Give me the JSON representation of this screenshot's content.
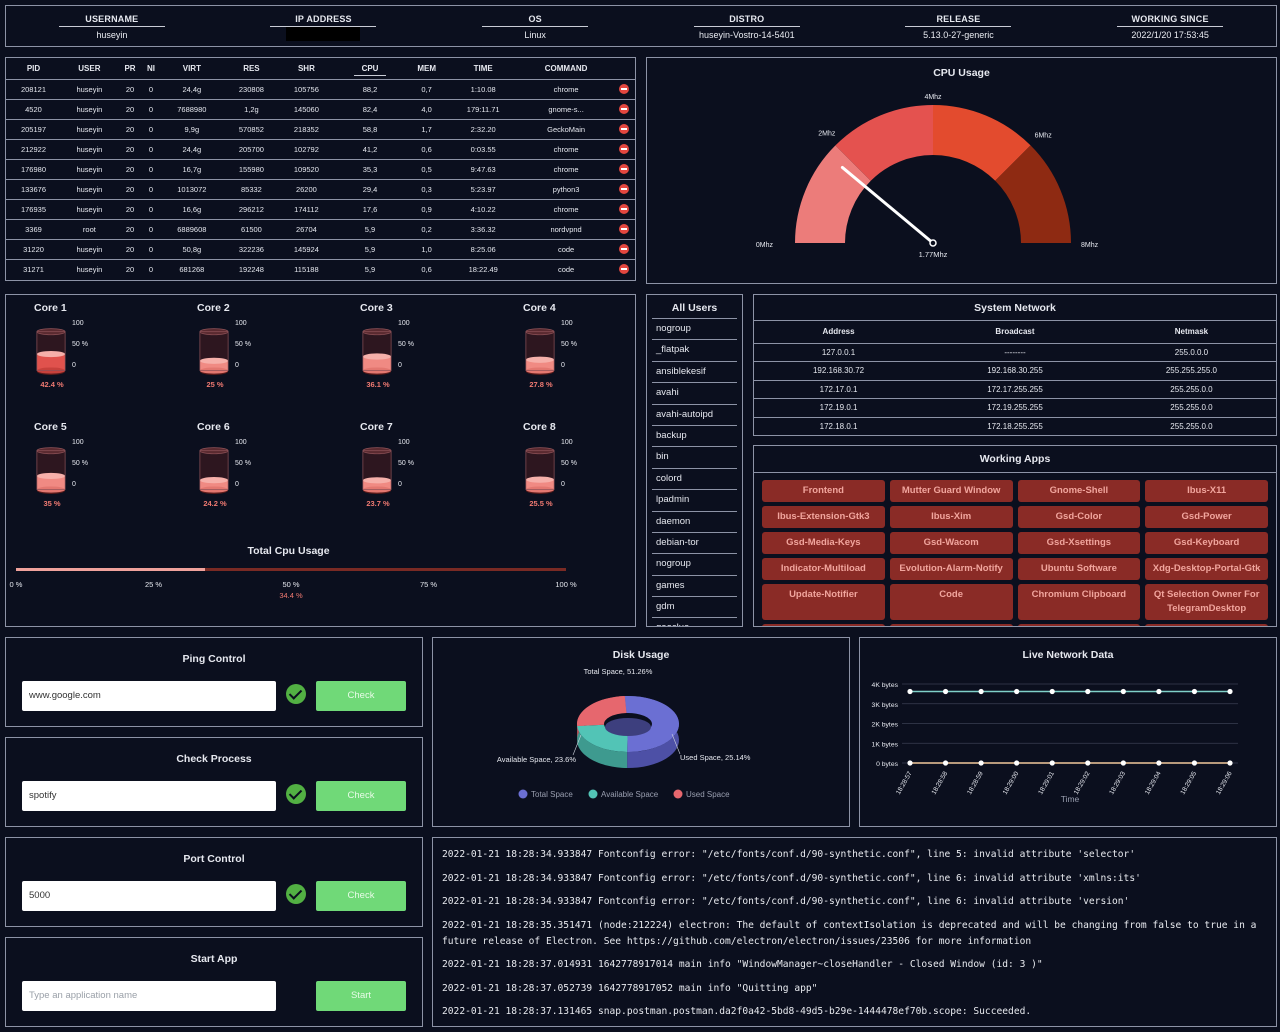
{
  "header": [
    {
      "title": "USERNAME",
      "value": "huseyin"
    },
    {
      "title": "IP ADDRESS",
      "value": "",
      "redacted": true
    },
    {
      "title": "OS",
      "value": "Linux"
    },
    {
      "title": "DISTRO",
      "value": "huseyin-Vostro-14-5401"
    },
    {
      "title": "RELEASE",
      "value": "5.13.0-27-generic"
    },
    {
      "title": "WORKING SINCE",
      "value": "2022/1/20 17:53:45"
    }
  ],
  "processes": {
    "columns": [
      "PID",
      "USER",
      "PR",
      "NI",
      "VIRT",
      "RES",
      "SHR",
      "CPU",
      "MEM",
      "TIME",
      "COMMAND"
    ],
    "rows": [
      [
        "208121",
        "huseyin",
        "20",
        "0",
        "24,4g",
        "230808",
        "105756",
        "88,2",
        "0,7",
        "1:10.08",
        "chrome"
      ],
      [
        "4520",
        "huseyin",
        "20",
        "0",
        "7688980",
        "1,2g",
        "145060",
        "82,4",
        "4,0",
        "179:11.71",
        "gnome-s..."
      ],
      [
        "205197",
        "huseyin",
        "20",
        "0",
        "9,9g",
        "570852",
        "218352",
        "58,8",
        "1,7",
        "2:32.20",
        "GeckoMain"
      ],
      [
        "212922",
        "huseyin",
        "20",
        "0",
        "24,4g",
        "205700",
        "102792",
        "41,2",
        "0,6",
        "0:03.55",
        "chrome"
      ],
      [
        "176980",
        "huseyin",
        "20",
        "0",
        "16,7g",
        "155980",
        "109520",
        "35,3",
        "0,5",
        "9:47.63",
        "chrome"
      ],
      [
        "133676",
        "huseyin",
        "20",
        "0",
        "1013072",
        "85332",
        "26200",
        "29,4",
        "0,3",
        "5:23.97",
        "python3"
      ],
      [
        "176935",
        "huseyin",
        "20",
        "0",
        "16,6g",
        "296212",
        "174112",
        "17,6",
        "0,9",
        "4:10.22",
        "chrome"
      ],
      [
        "3369",
        "root",
        "20",
        "0",
        "6889608",
        "61500",
        "26704",
        "5,9",
        "0,2",
        "3:36.32",
        "nordvpnd"
      ],
      [
        "31220",
        "huseyin",
        "20",
        "0",
        "50,8g",
        "322236",
        "145924",
        "5,9",
        "1,0",
        "8:25.06",
        "code"
      ],
      [
        "31271",
        "huseyin",
        "20",
        "0",
        "681268",
        "192248",
        "115188",
        "5,9",
        "0,6",
        "18:22.49",
        "code"
      ]
    ]
  },
  "cpu_gauge": {
    "title": "CPU Usage",
    "labels": [
      "0Mhz",
      "2Mhz",
      "4Mhz",
      "6Mhz",
      "8Mhz"
    ],
    "max": 8,
    "value": 1.77,
    "value_label": "1.77Mhz",
    "colors": [
      "#ec7c7a",
      "#e4524f",
      "#e34b2e",
      "#8e2a12"
    ]
  },
  "cores": [
    {
      "name": "Core 1",
      "value": 42.4,
      "label": "42.4 %"
    },
    {
      "name": "Core 2",
      "value": 25,
      "label": "25 %"
    },
    {
      "name": "Core 3",
      "value": 36.1,
      "label": "36.1 %"
    },
    {
      "name": "Core 4",
      "value": 27.8,
      "label": "27.8 %"
    },
    {
      "name": "Core 5",
      "value": 35,
      "label": "35 %"
    },
    {
      "name": "Core 6",
      "value": 24.2,
      "label": "24.2 %"
    },
    {
      "name": "Core 7",
      "value": 23.7,
      "label": "23.7 %"
    },
    {
      "name": "Core 8",
      "value": 25.5,
      "label": "25.5 %"
    }
  ],
  "core_scale": [
    "100",
    "50 %",
    "0"
  ],
  "total_cpu": {
    "title": "Total Cpu Usage",
    "value": 34.4,
    "label": "34.4 %",
    "ticks": [
      "0 %",
      "25 %",
      "50 %",
      "75 %",
      "100 %"
    ]
  },
  "users": {
    "title": "All Users",
    "items": [
      "nogroup",
      "_flatpak",
      "ansiblekesif",
      "avahi",
      "avahi-autoipd",
      "backup",
      "bin",
      "colord",
      "lpadmin",
      "daemon",
      "debian-tor",
      "nogroup",
      "games",
      "gdm",
      "geoclue"
    ]
  },
  "network": {
    "title": "System Network",
    "columns": [
      "Address",
      "Broadcast",
      "Netmask"
    ],
    "rows": [
      [
        "127.0.0.1",
        "--------",
        "255.0.0.0"
      ],
      [
        "192.168.30.72",
        "192.168.30.255",
        "255.255.255.0"
      ],
      [
        "172.17.0.1",
        "172.17.255.255",
        "255.255.0.0"
      ],
      [
        "172.19.0.1",
        "172.19.255.255",
        "255.255.0.0"
      ],
      [
        "172.18.0.1",
        "172.18.255.255",
        "255.255.0.0"
      ]
    ]
  },
  "apps": {
    "title": "Working Apps",
    "items": [
      "Frontend",
      "Mutter Guard Window",
      "Gnome-Shell",
      "Ibus-X11",
      "Ibus-Extension-Gtk3",
      "Ibus-Xim",
      "Gsd-Color",
      "Gsd-Power",
      "Gsd-Media-Keys",
      "Gsd-Wacom",
      "Gsd-Xsettings",
      "Gsd-Keyboard",
      "Indicator-Multiload",
      "Evolution-Alarm-Notify",
      "Ubuntu Software",
      "Xdg-Desktop-Portal-Gtk",
      "Update-Notifier",
      "Code",
      "Chromium Clipboard",
      "Qt Selection Owner For TelegramDesktop"
    ]
  },
  "controls": [
    {
      "title": "Ping Control",
      "value": "www.google.com",
      "placeholder": "",
      "button": "Check",
      "status": "ok"
    },
    {
      "title": "Check Process",
      "value": "spotify",
      "placeholder": "",
      "button": "Check",
      "status": "ok"
    },
    {
      "title": "Port Control",
      "value": "5000",
      "placeholder": "",
      "button": "Check",
      "status": "ok"
    },
    {
      "title": "Start App",
      "value": "",
      "placeholder": "Type an application name",
      "button": "Start",
      "status": "none"
    }
  ],
  "chart_data": [
    {
      "type": "pie",
      "title": "Disk Usage",
      "labels": [
        "Total Space",
        "Available Space",
        "Used Space"
      ],
      "values": [
        51.26,
        23.6,
        25.14
      ],
      "data_labels": [
        "Total Space, 51.26%",
        "Available Space, 23.6%",
        "Used Space, 25.14%"
      ],
      "colors": [
        "#6b6fd3",
        "#52c4b6",
        "#e6676e"
      ],
      "legend": "bottom"
    },
    {
      "type": "line",
      "title": "Live Network Data",
      "xlabel": "Time",
      "ylabel": "",
      "x": [
        "18:28:57",
        "18:28:58",
        "18:28:59",
        "18:29:00",
        "18:29:01",
        "18:29:02",
        "18:29:03",
        "18:29:04",
        "18:29:05",
        "18:29:06"
      ],
      "yticks": [
        "0 bytes",
        "1K bytes",
        "2K bytes",
        "3K bytes",
        "4K bytes"
      ],
      "ylim": [
        0,
        4000
      ],
      "series": [
        {
          "values": [
            3620,
            3620,
            3620,
            3620,
            3620,
            3620,
            3620,
            3620,
            3620,
            3620
          ],
          "color": "#7fd1c9"
        },
        {
          "values": [
            0,
            0,
            0,
            0,
            0,
            0,
            0,
            0,
            0,
            0
          ],
          "color": "#f2c99b"
        }
      ]
    }
  ],
  "log": [
    "2022-01-21 18:28:34.933847 Fontconfig error: \"/etc/fonts/conf.d/90-synthetic.conf\", line 5: invalid attribute 'selector'",
    "2022-01-21 18:28:34.933847 Fontconfig error: \"/etc/fonts/conf.d/90-synthetic.conf\", line 6: invalid attribute 'xmlns:its'",
    "2022-01-21 18:28:34.933847 Fontconfig error: \"/etc/fonts/conf.d/90-synthetic.conf\", line 6: invalid attribute 'version'",
    "2022-01-21 18:28:35.351471 (node:212224) electron: The default of contextIsolation is deprecated and will be changing from false to true in a future release of Electron. See https://github.com/electron/electron/issues/23506 for more information",
    "2022-01-21 18:28:37.014931 1642778917014 main info \"WindowManager~closeHandler - Closed Window (id: 3 )\"",
    "2022-01-21 18:28:37.052739 1642778917052 main info \"Quitting app\"",
    "2022-01-21 18:28:37.131465 snap.postman.postman.da2f0a42-5bd8-49d5-b29e-1444478ef70b.scope: Succeeded."
  ]
}
